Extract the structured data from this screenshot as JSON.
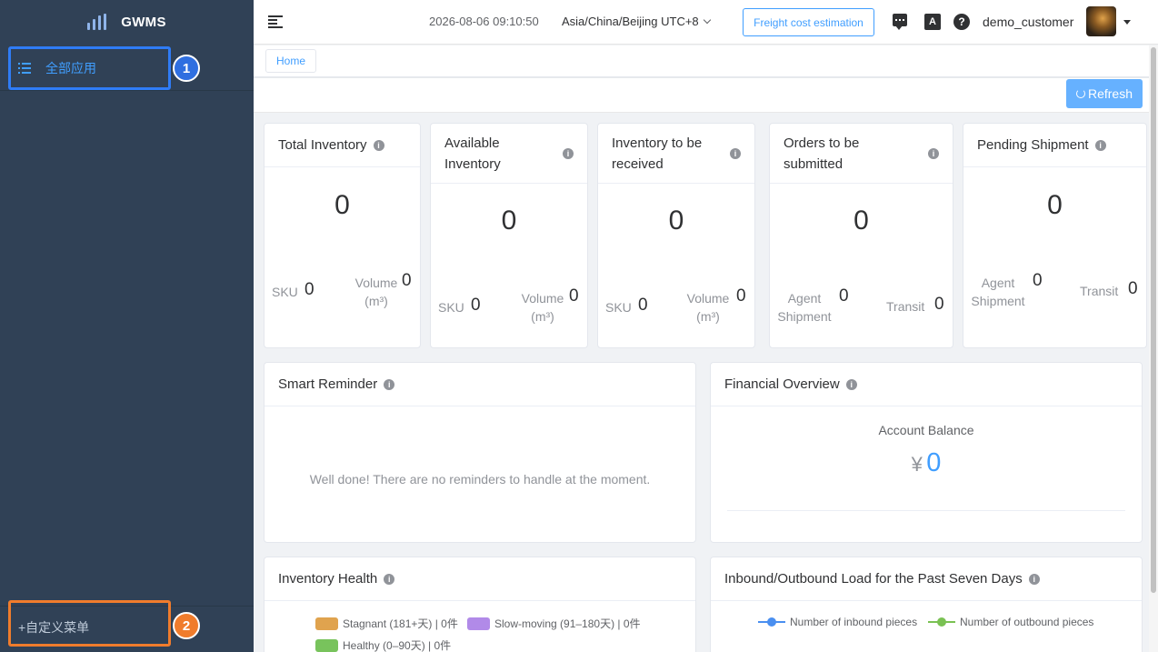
{
  "brand": {
    "name": "GWMS"
  },
  "sidebar": {
    "all_apps_label": "全部应用",
    "custom_menu_label": "+自定义菜单",
    "badges": [
      "1",
      "2"
    ]
  },
  "header": {
    "datetime": "2026-08-06 09:10:50",
    "timezone": "Asia/China/Beijing UTC+8",
    "freight_button": "Freight cost estimation",
    "lang_icon_text": "A",
    "help_icon_text": "?",
    "username": "demo_customer"
  },
  "tags": {
    "home": "Home"
  },
  "toolbar": {
    "refresh_label": "Refresh"
  },
  "stats": {
    "total_inventory": {
      "title": "Total Inventory",
      "value": "0",
      "sku_label": "SKU",
      "sku": "0",
      "volume_label": "Volume (m³)",
      "volume": "0"
    },
    "available_inventory": {
      "title": "Available Inventory",
      "value": "0",
      "sku_label": "SKU",
      "sku": "0",
      "volume_label": "Volume (m³)",
      "volume": "0"
    },
    "inventory_to_receive": {
      "title": "Inventory to be received",
      "value": "0",
      "sku_label": "SKU",
      "sku": "0",
      "volume_label": "Volume (m³)",
      "volume": "0"
    },
    "orders_to_submit": {
      "title": "Orders to be submitted",
      "value": "0",
      "agent_label": "Agent Shipment",
      "agent": "0",
      "transit_label": "Transit",
      "transit": "0"
    },
    "pending_shipment": {
      "title": "Pending Shipment",
      "value": "0",
      "agent_label": "Agent Shipment",
      "agent": "0",
      "transit_label": "Transit",
      "transit": "0"
    }
  },
  "smart_reminder": {
    "title": "Smart Reminder",
    "message": "Well done! There are no reminders to handle at the moment."
  },
  "financial": {
    "title": "Financial Overview",
    "balance_label": "Account Balance",
    "currency": "¥",
    "balance": "0"
  },
  "inventory_health": {
    "title": "Inventory Health",
    "legend": [
      {
        "label": "Stagnant (181+天) | 0件",
        "color": "#e0a34e"
      },
      {
        "label": "Slow-moving (91–180天) | 0件",
        "color": "#b18ae8"
      },
      {
        "label": "Healthy (0–90天) | 0件",
        "color": "#78c35c"
      }
    ]
  },
  "load": {
    "title": "Inbound/Outbound Load for the Past Seven Days",
    "legend": [
      {
        "label": "Number of inbound pieces",
        "color": "#4a8ff0"
      },
      {
        "label": "Number of outbound pieces",
        "color": "#7ac153"
      }
    ]
  },
  "info_icon_text": "i",
  "colors": {
    "sidebar": "#304156",
    "accent": "#409eff",
    "highlight_blue": "#2f7cf6",
    "highlight_orange": "#f07c2c"
  }
}
